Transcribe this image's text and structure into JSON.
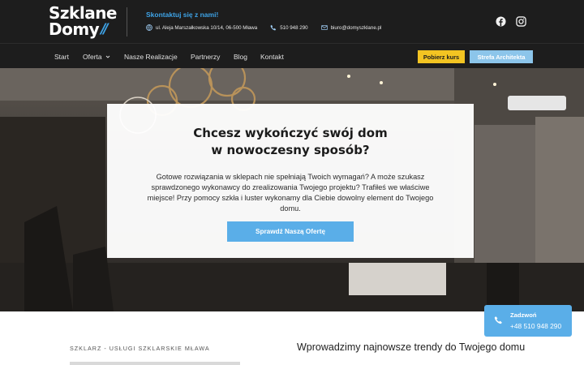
{
  "header": {
    "logo_line1": "Szklane",
    "logo_line2": "Domy",
    "contact_title": "Skontaktuj się z nami!",
    "address": "ul. Aleja Marszałkowska 10/14, 06-500 Mława",
    "phone": "510 948 290",
    "email": "biuro@domyszklane.pl"
  },
  "nav": {
    "items": [
      "Start",
      "Oferta",
      "Nasze Realizacje",
      "Partnerzy",
      "Blog",
      "Kontakt"
    ],
    "btn_kurs": "Pobierz kurs",
    "btn_arch": "Strefa Architekta"
  },
  "hero": {
    "title_line1": "Chcesz wykończyć swój dom",
    "title_line2": "w nowoczesny sposób?",
    "text": "Gotowe rozwiązania w sklepach nie spełniają Twoich wymagań? A może szukasz sprawdzonego wykonawcy do zrealizowania Twojego projektu? Trafiłeś we właściwe miejsce! Przy pomocy szkła i luster wykonamy dla Ciebie dowolny element do Twojego domu.",
    "button": "Sprawdź Naszą Ofertę"
  },
  "lower": {
    "tagline": "SZKLARZ - USŁUGI SZKLARSKIE MŁAWA",
    "heading": "Wprowadzimy najnowsze trendy do Twojego domu"
  },
  "call": {
    "label": "Zadzwoń",
    "number": "+48 510 948 290"
  },
  "colors": {
    "dark_bg": "#1d1d1d",
    "accent_blue": "#3ea4e8",
    "button_blue": "#5aaee8",
    "yellow": "#f3c422"
  },
  "icons": [
    "location-icon",
    "phone-icon",
    "mail-icon",
    "facebook-icon",
    "instagram-icon",
    "chevron-down-icon",
    "call-icon"
  ]
}
